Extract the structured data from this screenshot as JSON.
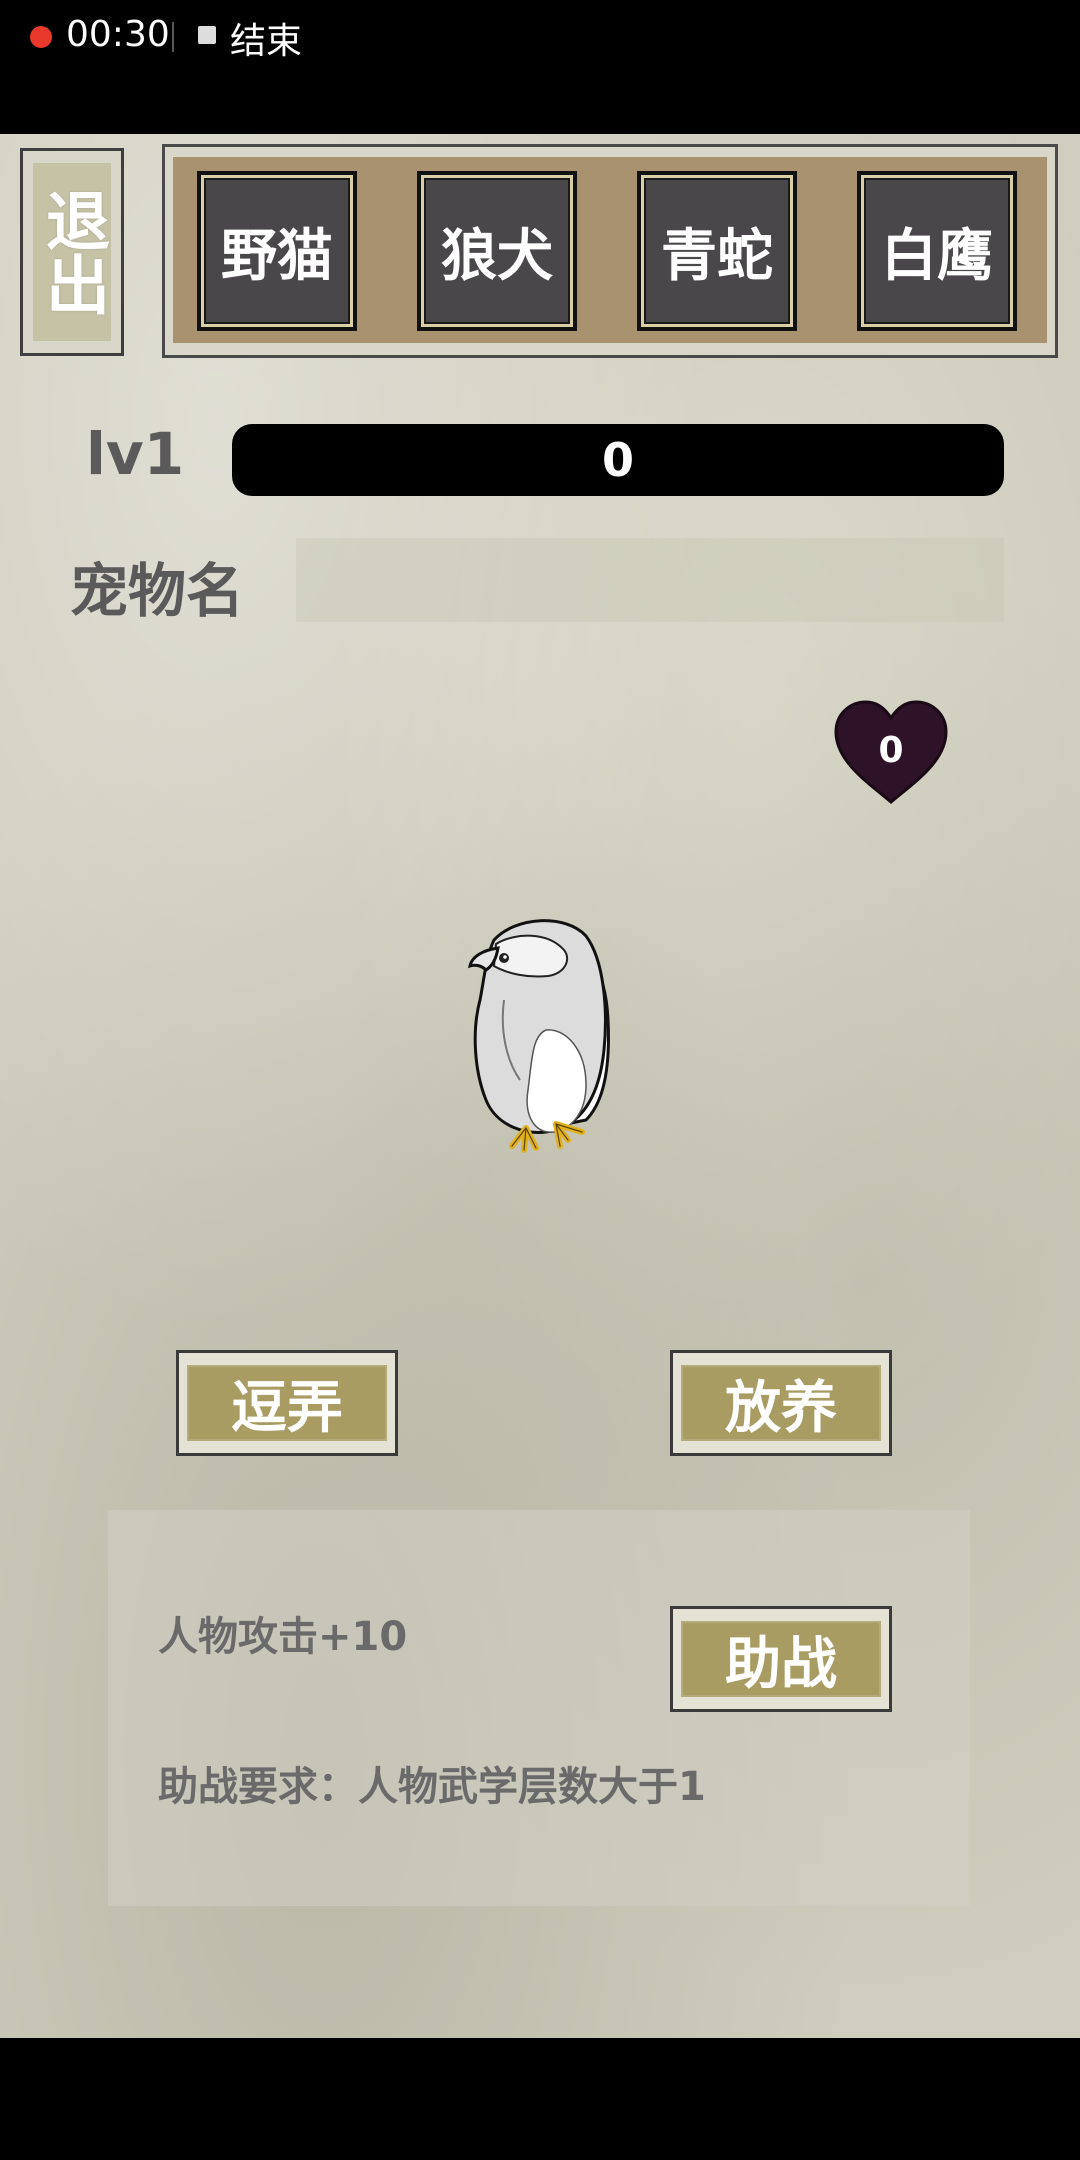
{
  "status_bar": {
    "recording_time": "00:30",
    "end_label": "结束"
  },
  "header": {
    "exit_label": "退出",
    "pet_tabs": [
      {
        "label": "野猫"
      },
      {
        "label": "狼犬"
      },
      {
        "label": "青蛇"
      },
      {
        "label": "白鹰"
      }
    ]
  },
  "pet": {
    "level": "lv1",
    "xp_value": "0",
    "name_label": "宠物名",
    "name_value": "",
    "affection": "0",
    "image": "white-eagle"
  },
  "actions": {
    "tease_label": "逗弄",
    "release_label": "放养"
  },
  "assist": {
    "bonus": "人物攻击+10",
    "button_label": "助战",
    "requirement": "助战要求：人物武学层数大于1"
  },
  "colors": {
    "heart": "#2e1228",
    "action_face": "#a99c62",
    "tab_face": "#4a474a",
    "tab_frame_bg": "#a89270",
    "record_dot": "#e8392c"
  }
}
